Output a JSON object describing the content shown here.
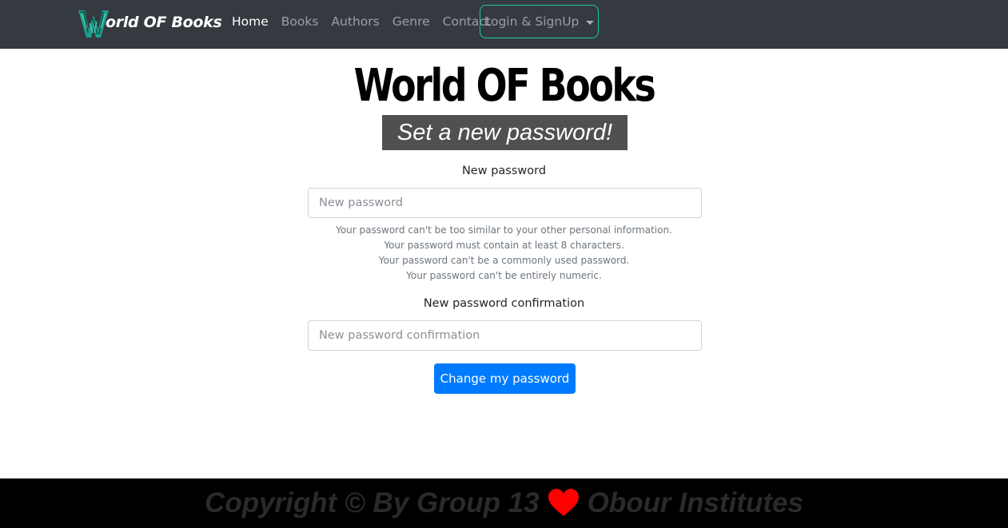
{
  "navbar": {
    "brand": "orld OF Books",
    "logo_icon": "butterfly-w-logo-icon",
    "links": [
      {
        "label": "Home",
        "active": true
      },
      {
        "label": "Books",
        "active": false
      },
      {
        "label": "Authors",
        "active": false
      },
      {
        "label": "Genre",
        "active": false
      },
      {
        "label": "Contact",
        "active": false
      }
    ],
    "dropdown_label": "Login & SignUp",
    "accent_color": "#20c997"
  },
  "main": {
    "title": "World OF Books",
    "subtitle": "Set a new password!",
    "new_password_label": "New password",
    "new_password_placeholder": "New password",
    "help_text": [
      "Your password can't be too similar to your other personal information.",
      "Your password must contain at least 8 characters.",
      "Your password can't be a commonly used password.",
      "Your password can't be entirely numeric."
    ],
    "confirm_label": "New password confirmation",
    "confirm_placeholder": "New password confirmation",
    "submit_label": "Change my password",
    "button_color": "#007bff"
  },
  "footer": {
    "text_before": "Copyright © By Group 13",
    "text_after": "Obour Institutes",
    "heart_icon": "heart-icon",
    "heart_color": "#ff0000"
  }
}
